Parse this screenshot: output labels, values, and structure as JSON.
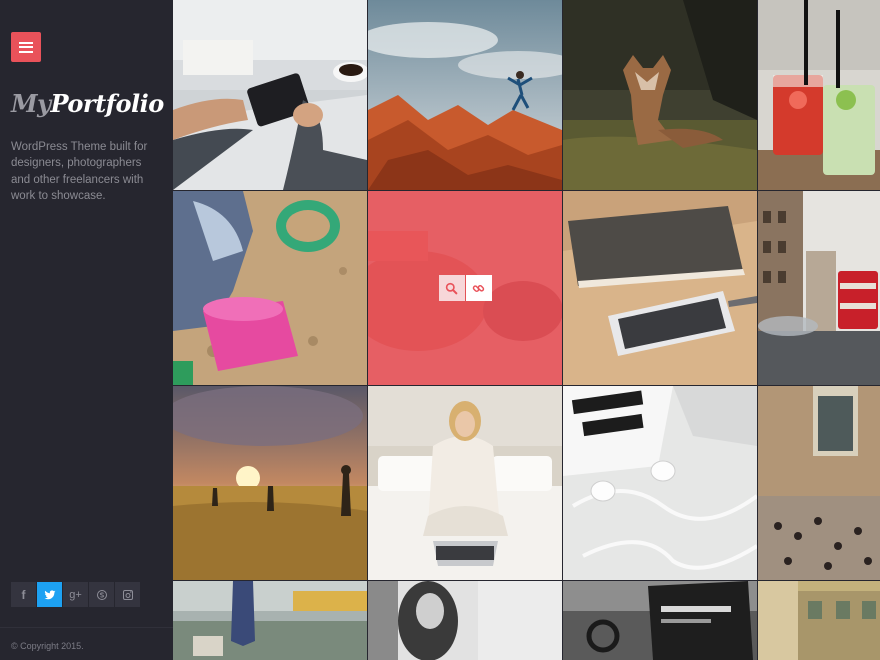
{
  "sidebar": {
    "menu_icon": "hamburger-icon",
    "logo_part1": "My",
    "logo_part2": "Portfolio",
    "tagline": "WordPress Theme built for designers, photographers and other freelancers with work to showcase.",
    "social": [
      {
        "name": "facebook",
        "glyph": "f"
      },
      {
        "name": "twitter",
        "glyph": ""
      },
      {
        "name": "google-plus",
        "glyph": "g+"
      },
      {
        "name": "skype",
        "glyph": "S"
      },
      {
        "name": "instagram",
        "glyph": ""
      }
    ],
    "copyright": "© Copyright 2015."
  },
  "grid": {
    "accent_color": "#e9525a",
    "tiles": [
      {
        "subject": "hands-tablet-coffee"
      },
      {
        "subject": "red-rocks-jumper"
      },
      {
        "subject": "fox-grass"
      },
      {
        "subject": "cocktails"
      },
      {
        "subject": "child-sand-bucket"
      },
      {
        "subject": "hover-overlay",
        "search_icon": "search-icon",
        "link_icon": "link-icon"
      },
      {
        "subject": "notebook-phone"
      },
      {
        "subject": "london-street-bus"
      },
      {
        "subject": "sunset-field"
      },
      {
        "subject": "woman-laptop-bed"
      },
      {
        "subject": "earphones-magazine"
      },
      {
        "subject": "train-station-crowd"
      },
      {
        "subject": "blurred-street"
      },
      {
        "subject": "bw-portrait"
      },
      {
        "subject": "car-dashboard"
      },
      {
        "subject": "building-facade"
      }
    ]
  }
}
